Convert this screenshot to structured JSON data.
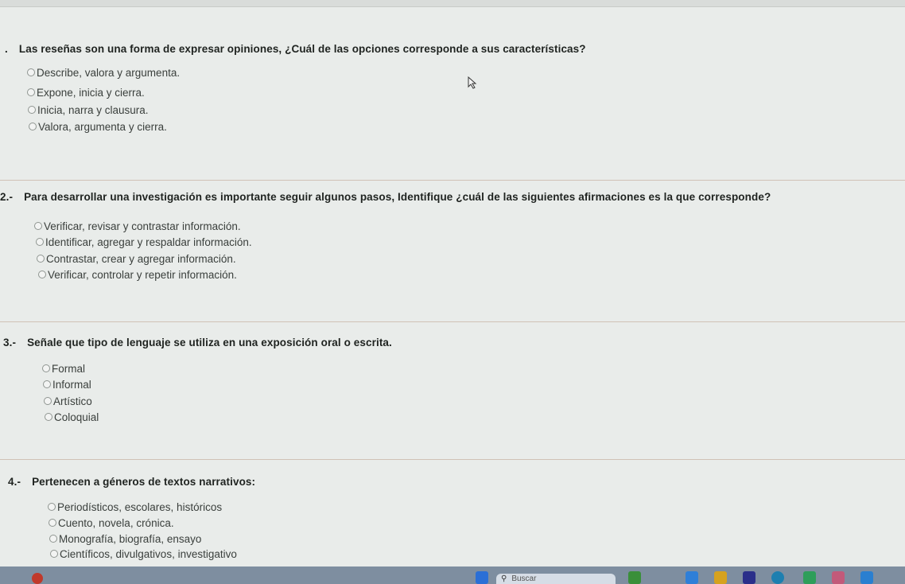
{
  "questions": [
    {
      "number": ".",
      "text": "Las reseñas son una forma de expresar opiniones, ¿Cuál de las opciones corresponde a sus características?",
      "options": [
        "Describe, valora y argumenta.",
        "Expone, inicia y cierra.",
        "Inicia, narra y clausura.",
        "Valora, argumenta y cierra."
      ]
    },
    {
      "number": "2.-",
      "text": "Para desarrollar una investigación es importante seguir algunos pasos, Identifique ¿cuál de las siguientes afirmaciones es la que corresponde?",
      "options": [
        "Verificar, revisar y contrastar información.",
        "Identificar, agregar y respaldar información.",
        "Contrastar, crear y agregar información.",
        "Verificar, controlar y repetir información."
      ]
    },
    {
      "number": "3.-",
      "text": "Señale que tipo de lenguaje se utiliza en una exposición oral o escrita.",
      "options": [
        "Formal",
        "Informal",
        "Artístico",
        "Coloquial"
      ]
    },
    {
      "number": "4.-",
      "text": "Pertenecen a géneros de textos narrativos:",
      "options": [
        "Periodísticos, escolares, históricos",
        "Cuento, novela, crónica.",
        "Monografía, biografía, ensayo",
        "Científicos, divulgativos, investigativo"
      ]
    }
  ],
  "taskbar": {
    "search_placeholder": "Buscar",
    "icons": [
      "windows-icon",
      "search-icon",
      "file-explorer-icon",
      "edge-icon",
      "chrome-icon",
      "store-icon",
      "mail-icon",
      "photos-icon",
      "settings-icon"
    ]
  },
  "colors": {
    "background": "#e9ecea",
    "separator": "#d0c2b6",
    "taskbar": "#7e8ea0"
  }
}
